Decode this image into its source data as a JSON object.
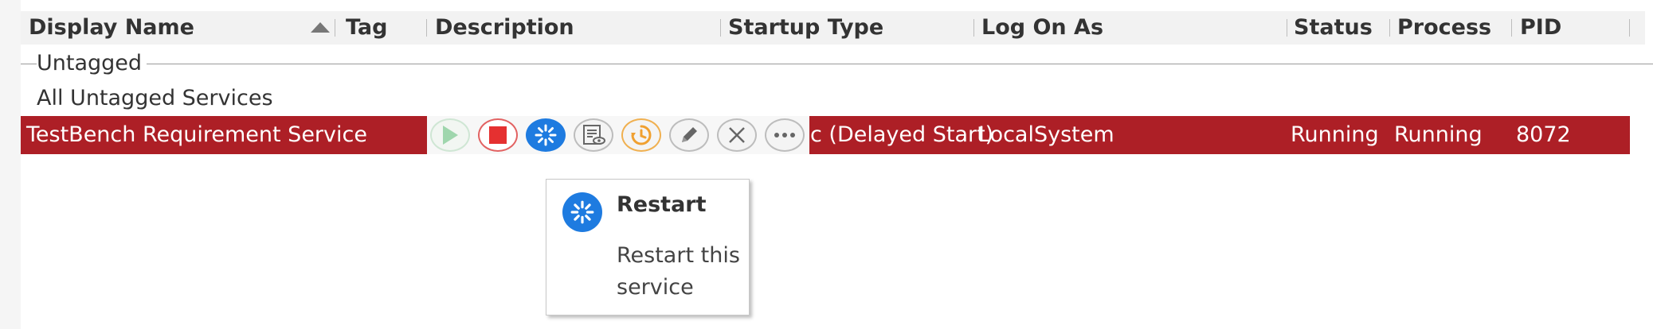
{
  "columns": {
    "display_name": "Display Name",
    "tag": "Tag",
    "description": "Description",
    "startup_type": "Startup Type",
    "log_on_as": "Log On As",
    "status": "Status",
    "process": "Process",
    "pid": "PID"
  },
  "sort": {
    "column": "display_name",
    "direction": "ascending",
    "icon": "sort-ascending-icon"
  },
  "group": {
    "label": "Untagged"
  },
  "subgroup": {
    "label": "All Untagged Services"
  },
  "selected_row": {
    "display_name": "TestBench Requirement Service",
    "startup_type": "c (Delayed Start)",
    "log_on_as": "LocalSystem",
    "status": "Running",
    "process": "Running",
    "pid": "8072"
  },
  "toolbar": {
    "buttons": [
      {
        "name": "start",
        "icon": "play-icon",
        "enabled": false
      },
      {
        "name": "stop",
        "icon": "stop-icon",
        "enabled": true
      },
      {
        "name": "restart",
        "icon": "restart-icon",
        "enabled": true,
        "hovered": true
      },
      {
        "name": "view-log",
        "icon": "log-view-icon",
        "enabled": true
      },
      {
        "name": "schedule",
        "icon": "clock-icon",
        "enabled": true
      },
      {
        "name": "edit",
        "icon": "pencil-icon",
        "enabled": true
      },
      {
        "name": "delete",
        "icon": "close-icon",
        "enabled": true
      },
      {
        "name": "more",
        "icon": "more-icon",
        "enabled": true
      }
    ]
  },
  "tooltip": {
    "title": "Restart",
    "description": "Restart this service",
    "icon": "restart-icon"
  },
  "colors": {
    "selection": "#ad1f26",
    "header_bg": "#f2f2f2",
    "accent_blue": "#1e7be0",
    "stop_red": "#e03131",
    "schedule_orange": "#f0a030",
    "play_green": "#8fcf9f"
  }
}
